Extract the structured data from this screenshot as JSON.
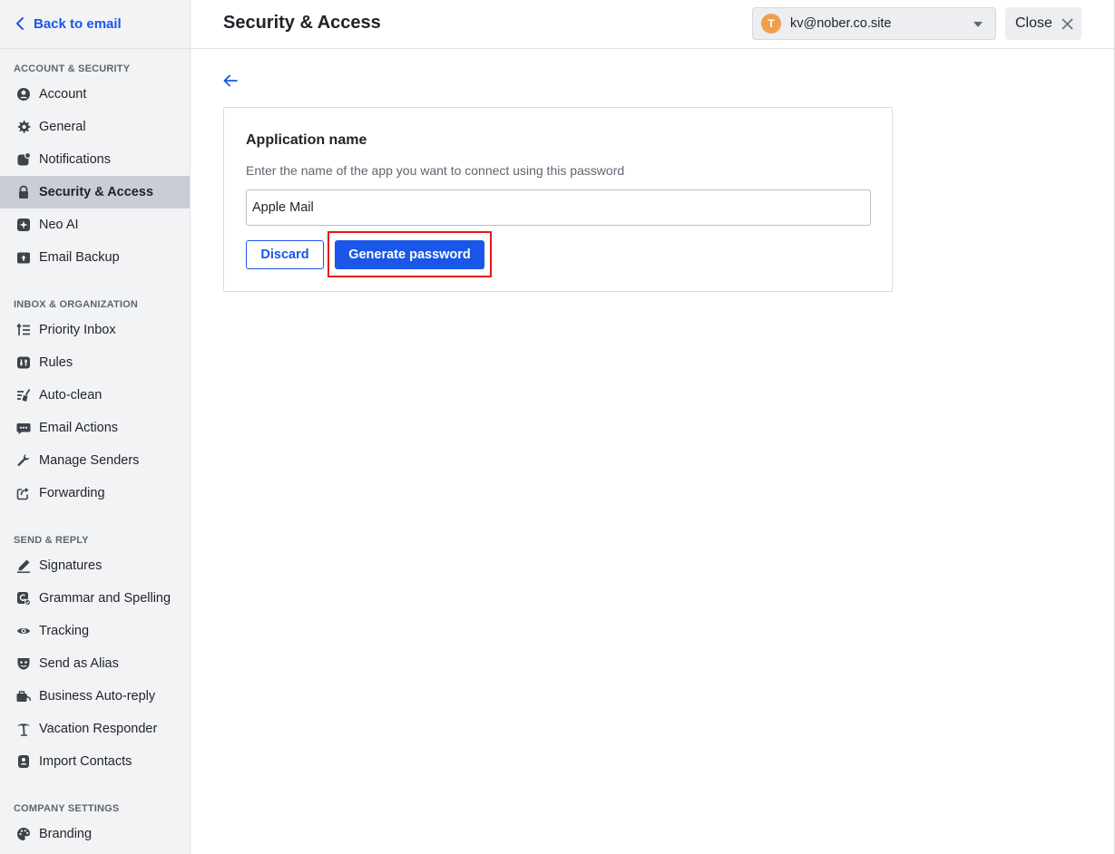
{
  "sidebar": {
    "back_label": "Back to email",
    "sections": [
      {
        "title": "ACCOUNT & SECURITY",
        "items": [
          {
            "label": "Account",
            "icon": "user-circle-icon"
          },
          {
            "label": "General",
            "icon": "gear-icon"
          },
          {
            "label": "Notifications",
            "icon": "bell-badge-icon"
          },
          {
            "label": "Security & Access",
            "icon": "lock-icon",
            "active": true
          },
          {
            "label": "Neo AI",
            "icon": "sparkle-icon"
          },
          {
            "label": "Email Backup",
            "icon": "cloud-upload-icon"
          }
        ]
      },
      {
        "title": "INBOX & ORGANIZATION",
        "items": [
          {
            "label": "Priority Inbox",
            "icon": "priority-list-icon"
          },
          {
            "label": "Rules",
            "icon": "rules-icon"
          },
          {
            "label": "Auto-clean",
            "icon": "broom-icon"
          },
          {
            "label": "Email Actions",
            "icon": "email-actions-icon"
          },
          {
            "label": "Manage Senders",
            "icon": "wrench-icon"
          },
          {
            "label": "Forwarding",
            "icon": "forward-icon"
          }
        ]
      },
      {
        "title": "SEND & REPLY",
        "items": [
          {
            "label": "Signatures",
            "icon": "pen-icon"
          },
          {
            "label": "Grammar and Spelling",
            "icon": "grammar-check-icon"
          },
          {
            "label": "Tracking",
            "icon": "eye-icon"
          },
          {
            "label": "Send as Alias",
            "icon": "alias-mask-icon"
          },
          {
            "label": "Business Auto-reply",
            "icon": "briefcase-reply-icon"
          },
          {
            "label": "Vacation Responder",
            "icon": "palm-tree-icon"
          },
          {
            "label": "Import Contacts",
            "icon": "contacts-import-icon"
          }
        ]
      },
      {
        "title": "COMPANY SETTINGS",
        "items": [
          {
            "label": "Branding",
            "icon": "palette-icon"
          }
        ]
      }
    ]
  },
  "header": {
    "title": "Security & Access",
    "account_initial": "T",
    "account_email": "kv@nober.co.site",
    "close_label": "Close"
  },
  "form": {
    "title": "Application name",
    "description": "Enter the name of the app you want to connect using this password",
    "input_value": "Apple Mail",
    "discard_label": "Discard",
    "generate_label": "Generate password"
  },
  "colors": {
    "accent": "#1a56e8",
    "highlight": "#e8141b",
    "avatar": "#f0a04b",
    "sidebar_active": "#c9ced6"
  }
}
